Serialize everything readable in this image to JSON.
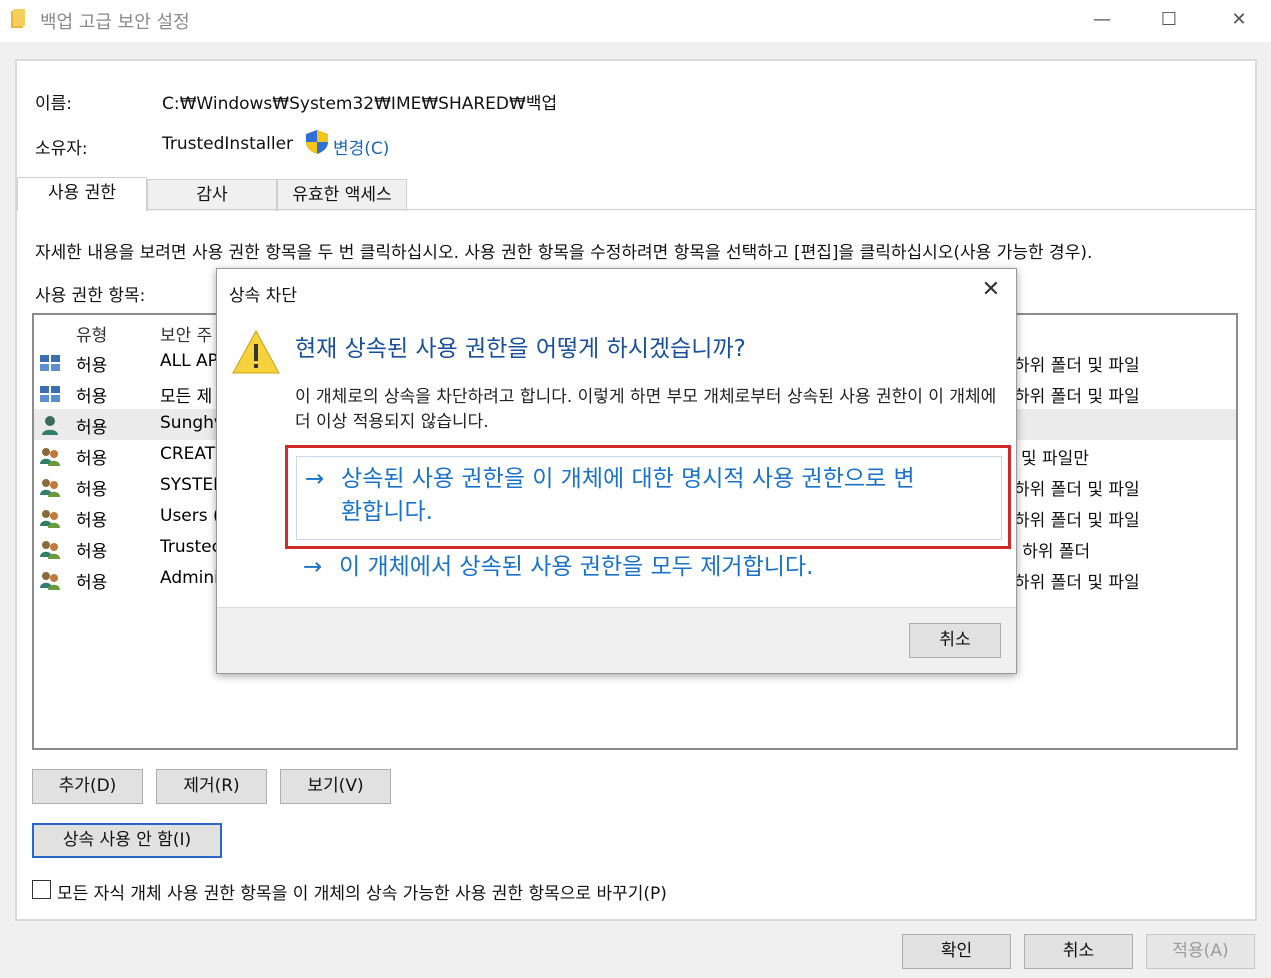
{
  "window": {
    "title": "백업 고급 보안 설정",
    "minimize_glyph": "—",
    "maximize_glyph": "☐",
    "close_glyph": "✕"
  },
  "info": {
    "name_label": "이름:",
    "name_value": "C:₩Windows₩System32₩IME₩SHARED₩백업",
    "owner_label": "소유자:",
    "owner_value": "TrustedInstaller",
    "change_link": "변경(C)"
  },
  "tabs": [
    {
      "label": "사용 권한",
      "active": true
    },
    {
      "label": "감사",
      "active": false
    },
    {
      "label": "유효한 액세스",
      "active": false
    }
  ],
  "instructions": "자세한 내용을 보려면 사용 권한 항목을 두 번 클릭하십시오. 사용 권한 항목을 수정하려면 항목을 선택하고 [편집]을 클릭하십시오(사용 가능한 경우).",
  "entries_label": "사용 권한 항목:",
  "table": {
    "headers": {
      "type": "유형",
      "principal": "보안 주"
    },
    "rows": [
      {
        "icon": "package-group-icon",
        "type": "허용",
        "principal": "ALL AP",
        "applies": "하위 폴더 및 파일",
        "selected": false
      },
      {
        "icon": "package-group-icon",
        "type": "허용",
        "principal": "모든 제",
        "applies": "하위 폴더 및 파일",
        "selected": false
      },
      {
        "icon": "user-icon",
        "type": "허용",
        "principal": "Sunghv",
        "applies": "",
        "selected": true
      },
      {
        "icon": "users-icon",
        "type": "허용",
        "principal": "CREATO",
        "applies": "및 파일만",
        "selected": false
      },
      {
        "icon": "users-icon",
        "type": "허용",
        "principal": "SYSTEN",
        "applies": "하위 폴더 및 파일",
        "selected": false
      },
      {
        "icon": "users-icon",
        "type": "허용",
        "principal": "Users (",
        "applies": "하위 폴더 및 파일",
        "selected": false
      },
      {
        "icon": "users-icon",
        "type": "허용",
        "principal": "Trustec",
        "applies": "! 하위 폴더",
        "selected": false
      },
      {
        "icon": "users-icon",
        "type": "허용",
        "principal": "Admini",
        "applies": "하위 폴더 및 파일",
        "selected": false
      }
    ]
  },
  "buttons": {
    "add": "추가(D)",
    "remove": "제거(R)",
    "view": "보기(V)",
    "disable_inheritance": "상속 사용 안 함(I)",
    "ok": "확인",
    "cancel": "취소",
    "apply": "적용(A)"
  },
  "replace_checkbox_label": "모든 자식 개체 사용 권한 항목을 이 개체의 상속 가능한 사용 권한 항목으로 바꾸기(P)",
  "dialog": {
    "title": "상속 차단",
    "close_glyph": "✕",
    "heading": "현재 상속된 사용 권한을 어떻게 하시겠습니까?",
    "description": "이 개체로의 상속을 차단하려고 합니다. 이렇게 하면 부모 개체로부터 상속된 사용 권한이 이 개체에 더 이상 적용되지 않습니다.",
    "option_convert_line1": "상속된 사용 권한을 이 개체에 대한 명시적 사용 권한으로 변",
    "option_convert_line2": "환합니다.",
    "option_remove": "이 개체에서 상속된 사용 권한을 모두 제거합니다.",
    "arrow": "→",
    "cancel": "취소"
  },
  "colors": {
    "accent_blue": "#1a73c9",
    "heading_blue": "#1a4f9c",
    "highlight_red": "#d12a2a"
  }
}
